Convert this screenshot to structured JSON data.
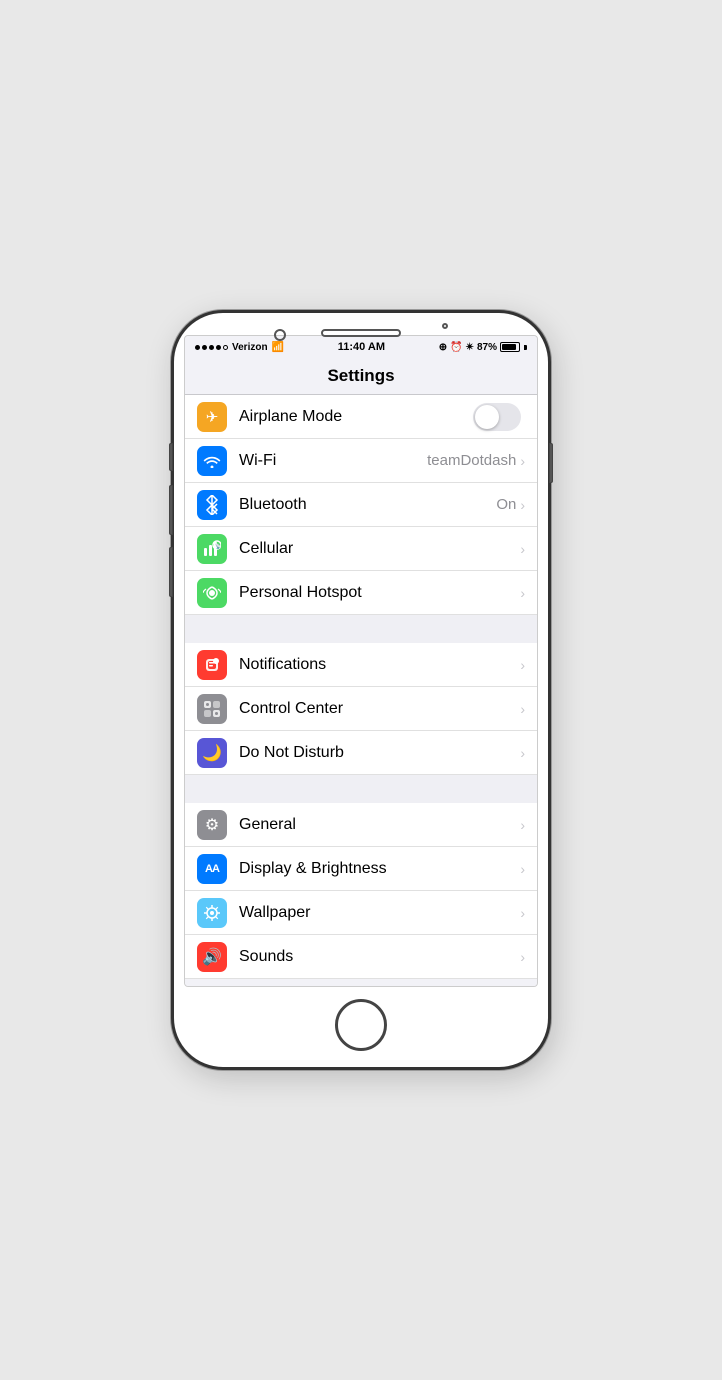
{
  "status": {
    "carrier": "Verizon",
    "signal_dots": 4,
    "time": "11:40 AM",
    "battery_percent": "87%",
    "bluetooth_symbol": "ᛒ"
  },
  "nav": {
    "title": "Settings"
  },
  "sections": [
    {
      "id": "connectivity",
      "rows": [
        {
          "id": "airplane-mode",
          "label": "Airplane Mode",
          "icon": "✈",
          "icon_class": "icon-orange",
          "type": "toggle",
          "toggle_on": false
        },
        {
          "id": "wifi",
          "label": "Wi-Fi",
          "icon": "📶",
          "icon_class": "icon-blue",
          "type": "value-chevron",
          "value": "teamDotdash"
        },
        {
          "id": "bluetooth",
          "label": "Bluetooth",
          "icon": "ᛒ",
          "icon_class": "icon-blue-bt",
          "type": "value-chevron",
          "value": "On"
        },
        {
          "id": "cellular",
          "label": "Cellular",
          "icon": "📡",
          "icon_class": "icon-green",
          "type": "chevron",
          "value": ""
        },
        {
          "id": "personal-hotspot",
          "label": "Personal Hotspot",
          "icon": "♾",
          "icon_class": "icon-green-hotspot",
          "type": "chevron",
          "value": ""
        }
      ]
    },
    {
      "id": "system1",
      "rows": [
        {
          "id": "notifications",
          "label": "Notifications",
          "icon": "🔔",
          "icon_class": "icon-red",
          "type": "chevron",
          "value": ""
        },
        {
          "id": "control-center",
          "label": "Control Center",
          "icon": "⊞",
          "icon_class": "icon-gray",
          "type": "chevron",
          "value": ""
        },
        {
          "id": "do-not-disturb",
          "label": "Do Not Disturb",
          "icon": "🌙",
          "icon_class": "icon-purple",
          "type": "chevron",
          "value": ""
        }
      ]
    },
    {
      "id": "system2",
      "rows": [
        {
          "id": "general",
          "label": "General",
          "icon": "⚙",
          "icon_class": "icon-gray",
          "type": "chevron",
          "value": ""
        },
        {
          "id": "display-brightness",
          "label": "Display & Brightness",
          "icon": "AA",
          "icon_class": "icon-blue-aa",
          "type": "chevron",
          "value": ""
        },
        {
          "id": "wallpaper",
          "label": "Wallpaper",
          "icon": "✿",
          "icon_class": "icon-teal",
          "type": "chevron",
          "value": ""
        },
        {
          "id": "sounds",
          "label": "Sounds",
          "icon": "🔊",
          "icon_class": "icon-red-sounds",
          "type": "chevron",
          "value": ""
        }
      ]
    }
  ],
  "icons": {
    "chevron": "›",
    "wifi_signal": "wifi",
    "bluetooth": "bluetooth"
  }
}
